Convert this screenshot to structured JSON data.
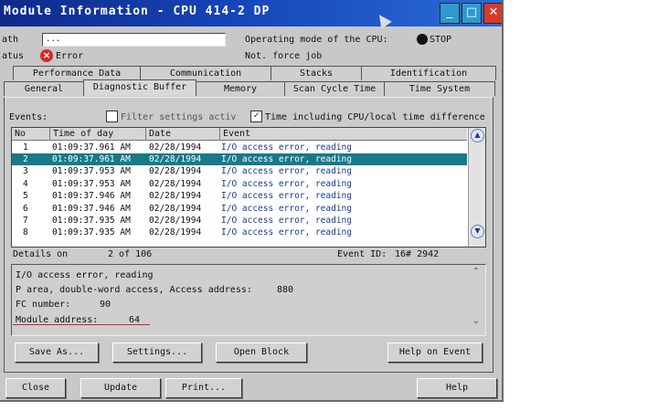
{
  "window": {
    "title": "Module Information - CPU 414-2 DP",
    "controls": {
      "minimize": "_",
      "maximize": "□",
      "close": "✕"
    }
  },
  "header": {
    "path_label": "ath",
    "path_value": "...",
    "status_label": "atus",
    "status_value": "Error",
    "operating_mode_label": "Operating mode of the CPU:",
    "operating_mode_value": "STOP",
    "not_force_label": "Not. force job"
  },
  "tabs_back": [
    "Performance Data",
    "Communication",
    "Stacks",
    "Identification"
  ],
  "tabs_front": [
    "General",
    "Diagnostic Buffer",
    "Memory",
    "Scan Cycle Time",
    "Time System"
  ],
  "filter": {
    "events_label": "Events:",
    "filter_settings_label": "Filter settings activ",
    "time_including_label": "Time including CPU/local time difference"
  },
  "table": {
    "columns": [
      "No",
      "Time of day",
      "Date",
      "Event"
    ],
    "rows": [
      {
        "no": "1",
        "time": "01:09:37.961 AM",
        "date": "02/28/1994",
        "event": "I/O access error, reading"
      },
      {
        "no": "2",
        "time": "01:09:37.961 AM",
        "date": "02/28/1994",
        "event": "I/O access error, reading"
      },
      {
        "no": "3",
        "time": "01:09:37.953 AM",
        "date": "02/28/1994",
        "event": "I/O access error, reading"
      },
      {
        "no": "4",
        "time": "01:09:37.953 AM",
        "date": "02/28/1994",
        "event": "I/O access error, reading"
      },
      {
        "no": "5",
        "time": "01:09:37.946 AM",
        "date": "02/28/1994",
        "event": "I/O access error, reading"
      },
      {
        "no": "6",
        "time": "01:09:37.946 AM",
        "date": "02/28/1994",
        "event": "I/O access error, reading"
      },
      {
        "no": "7",
        "time": "01:09:37.935 AM",
        "date": "02/28/1994",
        "event": "I/O access error, reading"
      },
      {
        "no": "8",
        "time": "01:09:37.935 AM",
        "date": "02/28/1994",
        "event": "I/O access error, reading"
      }
    ],
    "selected_row": 2
  },
  "details": {
    "details_label": "Details on",
    "details_value": "2 of 106",
    "event_id_label": "Event ID:",
    "event_id_value": "16# 2942",
    "line1": "I/O access error, reading",
    "line2": "P area, double-word access, Access address:",
    "line2_value": "880",
    "fc_label": "FC number:",
    "fc_value": "90",
    "module_label": "Module address:",
    "module_value": "64"
  },
  "buttons": {
    "save_as": "Save As...",
    "settings": "Settings...",
    "open_block": "Open Block",
    "help_on_event": "Help on Event",
    "close": "Close",
    "update": "Update",
    "print": "Print...",
    "help": "Help"
  }
}
